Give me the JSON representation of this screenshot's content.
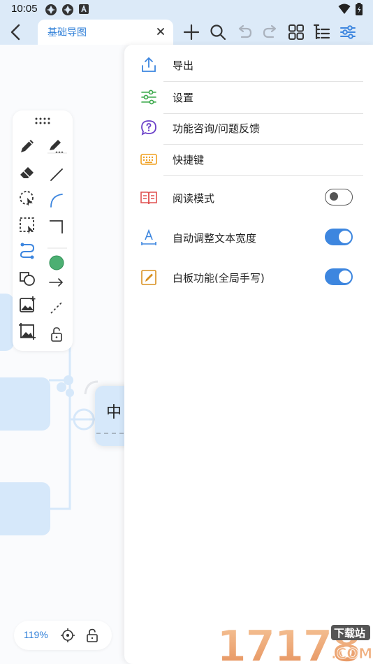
{
  "status_bar": {
    "time": "10:05"
  },
  "toolbar": {
    "tab_title": "基础导图",
    "tab_close": "×"
  },
  "canvas": {
    "center_node_text": "中",
    "zoom_level": "119%"
  },
  "settings_menu": {
    "items": [
      {
        "label": "导出",
        "icon": "export-icon"
      },
      {
        "label": "设置",
        "icon": "settings-sliders-icon"
      },
      {
        "label": "功能咨询/问题反馈",
        "icon": "help-icon"
      },
      {
        "label": "快捷键",
        "icon": "keyboard-icon"
      },
      {
        "label": "阅读模式",
        "icon": "book-icon",
        "toggle": false
      },
      {
        "label": "自动调整文本宽度",
        "icon": "text-width-icon",
        "toggle": true
      },
      {
        "label": "白板功能(全局手写)",
        "icon": "whiteboard-icon",
        "toggle": true
      }
    ]
  },
  "watermark": {
    "text": "17178",
    "badge": "下载站",
    "suffix": ".COM"
  },
  "colors": {
    "accent": "#3d86df",
    "header_bg": "#dceaf8",
    "node_bg": "#d6e8fa",
    "export_icon": "#3d86df",
    "settings_icon": "#3aa84a",
    "help_icon": "#6a3fc8",
    "keyboard_icon": "#f0a020",
    "book_icon": "#e05050",
    "text_width_icon": "#3d86df",
    "whiteboard_icon": "#d89020"
  }
}
